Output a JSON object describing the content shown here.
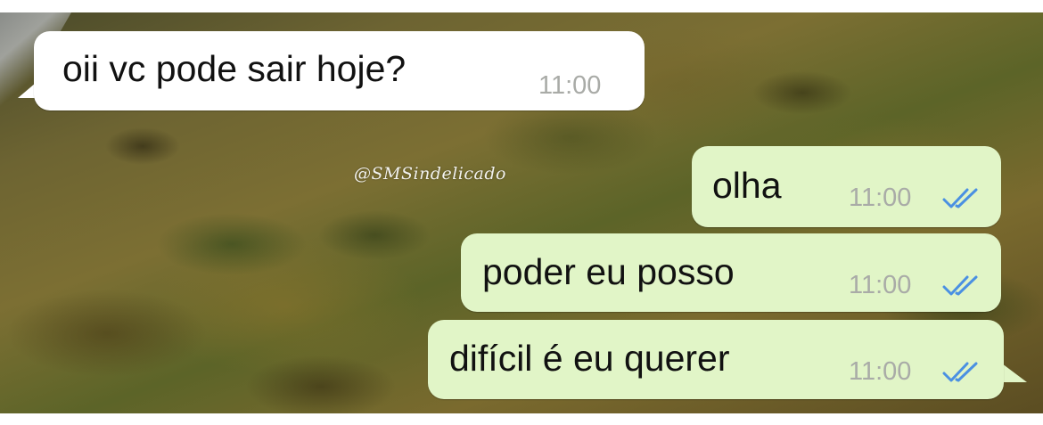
{
  "watermark": "@SMSindelicado",
  "messages": [
    {
      "direction": "incoming",
      "text": "oii vc pode sair hoje?",
      "time": "11:00"
    },
    {
      "direction": "outgoing",
      "text": "olha",
      "time": "11:00",
      "status_icon": "double-check-icon"
    },
    {
      "direction": "outgoing",
      "text": "poder eu posso",
      "time": "11:00",
      "status_icon": "double-check-icon"
    },
    {
      "direction": "outgoing",
      "text": "difícil é eu querer",
      "time": "11:00",
      "status_icon": "double-check-icon"
    }
  ],
  "colors": {
    "incoming_bubble": "#ffffff",
    "outgoing_bubble": "#e1f5c7",
    "timestamp": "#a9aba7",
    "read_ticks": "#4a90e2"
  }
}
